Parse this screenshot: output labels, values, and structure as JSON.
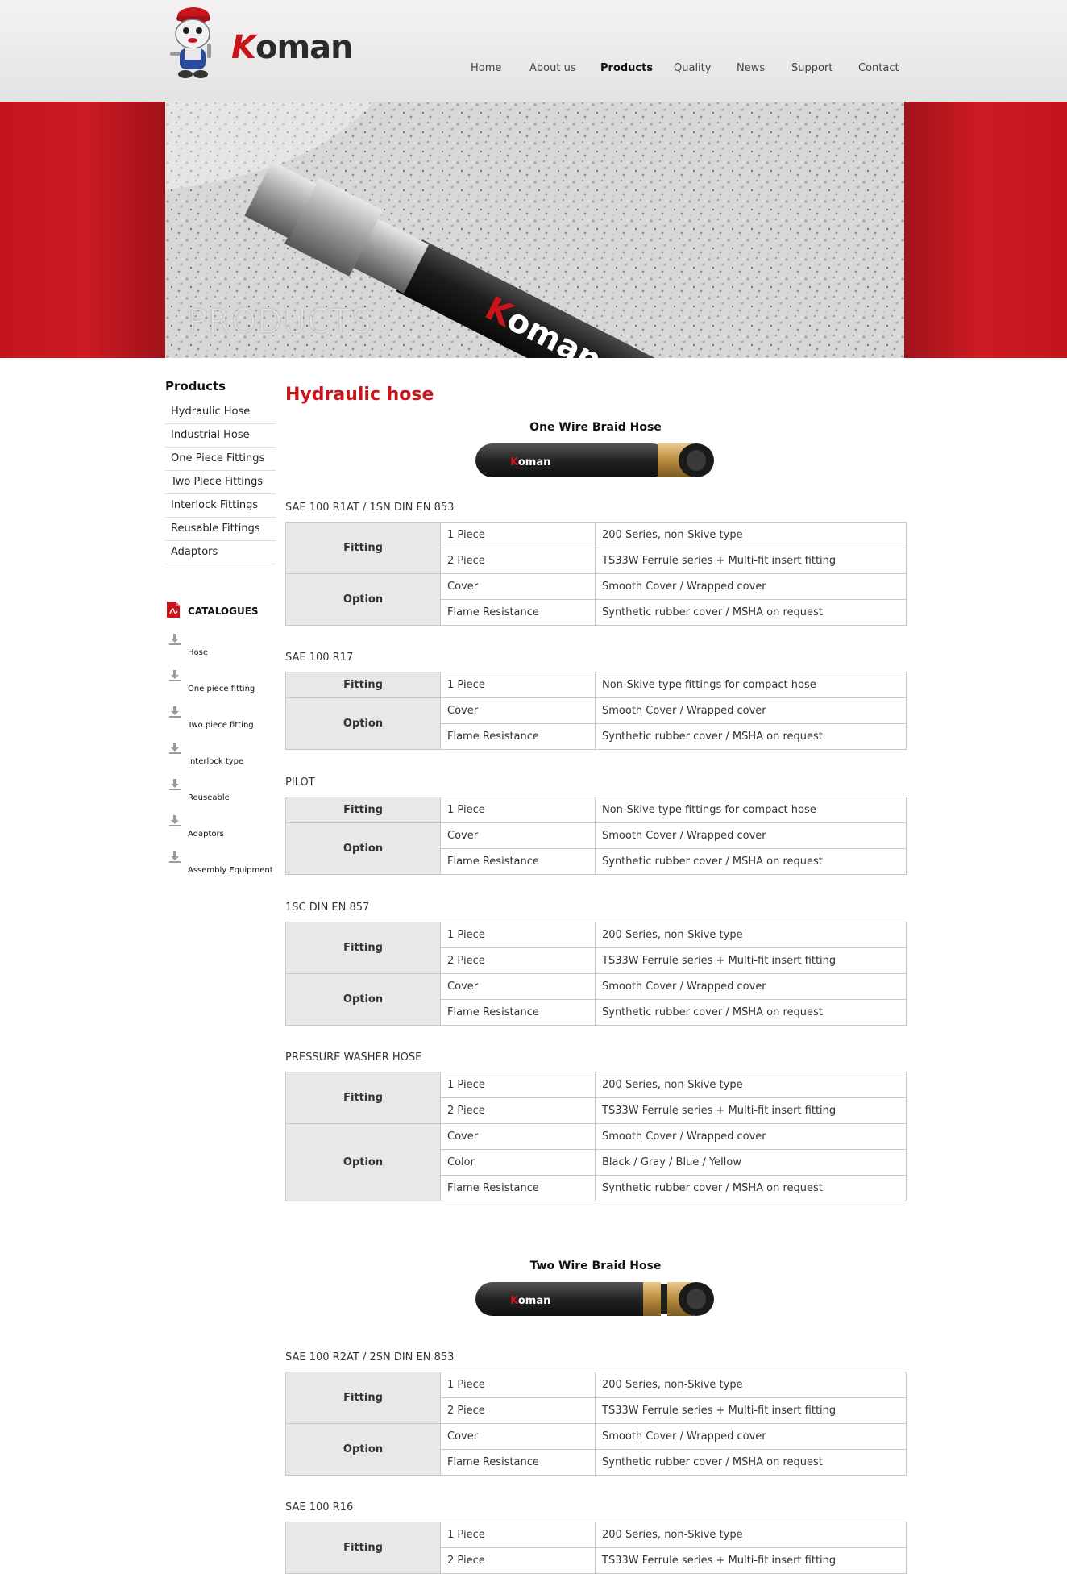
{
  "brand": {
    "logo_text": "oman",
    "logo_initial": "K"
  },
  "nav": [
    "Home",
    "About us",
    "Products",
    "Quality",
    "News",
    "Support",
    "Contact"
  ],
  "nav_active": "Products",
  "banner": {
    "title": "PRODUCTS",
    "hose_text": "oman DIN - EN",
    "hose_k": "K"
  },
  "sidebar": {
    "title": "Products",
    "items": [
      "Hydraulic Hose",
      "Industrial Hose",
      "One Piece Fittings",
      "Two Piece Fittings",
      "Interlock Fittings",
      "Reusable Fittings",
      "Adaptors"
    ],
    "catalogues_title": "CATALOGUES",
    "catalogues": [
      "Hose",
      "One piece fitting",
      "Two piece fitting",
      "Interlock type",
      "Reuseable",
      "Adaptors",
      "Assembly Equipment"
    ]
  },
  "main": {
    "title": "Hydraulic hose",
    "sections": [
      {
        "title": "One Wire Braid Hose",
        "hose_logo": "oman",
        "hose_logo_k": "K",
        "tables": [
          {
            "label": "SAE 100 R1AT / 1SN DIN EN 853",
            "groups": [
              {
                "name": "Fitting",
                "rows": [
                  [
                    "1 Piece",
                    "200 Series, non-Skive type"
                  ],
                  [
                    "2 Piece",
                    "TS33W Ferrule series + Multi-fit insert fitting"
                  ]
                ]
              },
              {
                "name": "Option",
                "rows": [
                  [
                    "Cover",
                    "Smooth Cover / Wrapped cover"
                  ],
                  [
                    "Flame Resistance",
                    "Synthetic rubber cover /  MSHA on request"
                  ]
                ]
              }
            ]
          },
          {
            "label": "SAE 100 R17",
            "groups": [
              {
                "name": "Fitting",
                "rows": [
                  [
                    "1 Piece",
                    "Non-Skive type fittings for compact hose"
                  ]
                ]
              },
              {
                "name": "Option",
                "rows": [
                  [
                    "Cover",
                    "Smooth Cover / Wrapped cover"
                  ],
                  [
                    "Flame Resistance",
                    "Synthetic rubber cover /  MSHA on request"
                  ]
                ]
              }
            ]
          },
          {
            "label": "PILOT",
            "groups": [
              {
                "name": "Fitting",
                "rows": [
                  [
                    "1 Piece",
                    "Non-Skive type fittings for compact hose"
                  ]
                ]
              },
              {
                "name": "Option",
                "rows": [
                  [
                    "Cover",
                    "Smooth Cover / Wrapped cover"
                  ],
                  [
                    "Flame Resistance",
                    "Synthetic rubber cover /  MSHA on request"
                  ]
                ]
              }
            ]
          },
          {
            "label": "1SC DIN EN 857",
            "groups": [
              {
                "name": "Fitting",
                "rows": [
                  [
                    "1 Piece",
                    "200 Series, non-Skive type"
                  ],
                  [
                    "2 Piece",
                    "TS33W Ferrule series + Multi-fit insert fitting"
                  ]
                ]
              },
              {
                "name": "Option",
                "rows": [
                  [
                    "Cover",
                    "Smooth Cover / Wrapped cover"
                  ],
                  [
                    "Flame Resistance",
                    "Synthetic rubber cover /  MSHA on request"
                  ]
                ]
              }
            ]
          },
          {
            "label": "PRESSURE WASHER HOSE",
            "groups": [
              {
                "name": "Fitting",
                "rows": [
                  [
                    "1 Piece",
                    "200 Series, non-Skive type"
                  ],
                  [
                    "2 Piece",
                    "TS33W Ferrule series + Multi-fit insert fitting"
                  ]
                ]
              },
              {
                "name": "Option",
                "rows": [
                  [
                    "Cover",
                    "Smooth Cover / Wrapped cover"
                  ],
                  [
                    "Color",
                    "Black / Gray / Blue / Yellow"
                  ],
                  [
                    "Flame Resistance",
                    "Synthetic rubber cover /  MSHA on request"
                  ]
                ]
              }
            ]
          }
        ]
      },
      {
        "title": "Two Wire Braid Hose",
        "hose_logo": "oman",
        "hose_logo_k": "K",
        "tables": [
          {
            "label": "SAE 100 R2AT / 2SN DIN EN 853",
            "groups": [
              {
                "name": "Fitting",
                "rows": [
                  [
                    "1 Piece",
                    "200 Series, non-Skive type"
                  ],
                  [
                    "2 Piece",
                    "TS33W Ferrule series + Multi-fit insert fitting"
                  ]
                ]
              },
              {
                "name": "Option",
                "rows": [
                  [
                    "Cover",
                    "Smooth Cover / Wrapped cover"
                  ],
                  [
                    "Flame Resistance",
                    "Synthetic rubber cover /  MSHA on request"
                  ]
                ]
              }
            ]
          },
          {
            "label": "SAE 100 R16",
            "groups": [
              {
                "name": "Fitting",
                "rows": [
                  [
                    "1 Piece",
                    "200 Series, non-Skive type"
                  ],
                  [
                    "2 Piece",
                    "TS33W Ferrule series + Multi-fit insert fitting"
                  ]
                ]
              }
            ]
          }
        ]
      }
    ]
  },
  "colors": {
    "brand_red": "#c8141c",
    "header_header_bg": "#ececec",
    "table_head_bg": "#e8e8e8",
    "table_border": "#c8c8c8"
  }
}
